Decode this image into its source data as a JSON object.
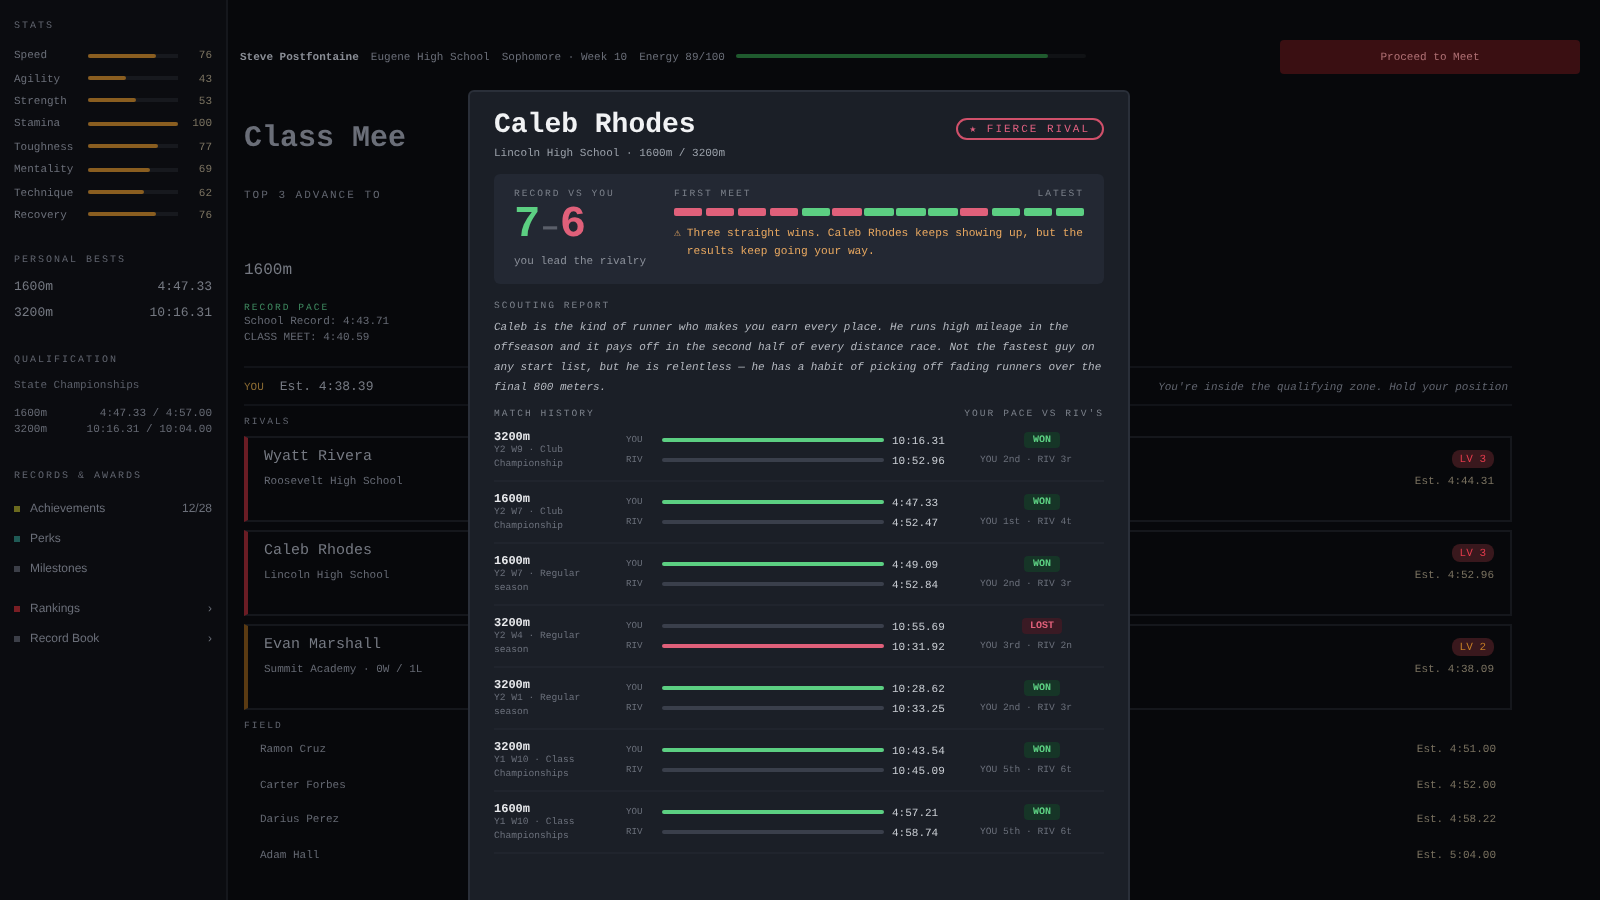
{
  "sidebar": {
    "stats_title": "STATS",
    "stats": [
      {
        "name": "Speed",
        "level": 0.76,
        "value": "76"
      },
      {
        "name": "Agility",
        "level": 0.43,
        "value": "43"
      },
      {
        "name": "Strength",
        "level": 0.53,
        "value": "53"
      },
      {
        "name": "Stamina",
        "level": 1.0,
        "value": "100"
      },
      {
        "name": "Toughness",
        "level": 0.77,
        "value": "77"
      },
      {
        "name": "Mentality",
        "level": 0.69,
        "value": "69"
      },
      {
        "name": "Technique",
        "level": 0.62,
        "value": "62"
      },
      {
        "name": "Recovery",
        "level": 0.76,
        "value": "76"
      }
    ],
    "bests_title": "PERSONAL BESTS",
    "bests": [
      {
        "event": "1600m",
        "time": "4:47.33"
      },
      {
        "event": "3200m",
        "time": "10:16.31"
      }
    ],
    "qualification_title": "QUALIFICATION",
    "qualification_meet": "State Championships",
    "qualification": [
      {
        "event": "1600m",
        "time": "4:47.33 / 4:57.00"
      },
      {
        "event": "3200m",
        "time": "10:16.31 / 10:04.00"
      }
    ],
    "records_title": "RECORDS & AWARDS",
    "records": [
      {
        "label": "Achievements",
        "count": "12/28",
        "color": "#6b6a1e"
      },
      {
        "label": "Perks",
        "color": "#1f5a55"
      },
      {
        "label": "Milestones",
        "color": "#3c3f48"
      }
    ],
    "links": [
      {
        "label": "Rankings",
        "chevron": "›",
        "color": "#7a1e24"
      },
      {
        "label": "Record Book",
        "chevron": "›",
        "color": "#3c3f48"
      }
    ]
  },
  "top_bar": {
    "athlete": "Steve Postfontaine",
    "school": "Eugene High School",
    "season": "Sophomore · Week 10",
    "energy": "Energy 89/100",
    "level": 0.89,
    "button": "Proceed to Meet"
  },
  "meet": {
    "title": "Class Mee",
    "rule": "TOP 3 ADVANCE TO",
    "event": "1600m",
    "record_title": "RECORD PACE",
    "records": [
      "School Record: 4:43.71",
      "CLASS MEET: 4:40.59"
    ],
    "you_label": "YOU",
    "you_estimate": "Est. 4:38.39",
    "you_message": "You're inside the qualifying zone. Hold your position",
    "rivals_title": "RIVALS",
    "rivals": [
      {
        "name": "Wyatt Rivera",
        "school": "Roosevelt High School",
        "badge": "LV 3",
        "estimate": "Est. 4:44.31",
        "color": "#6a1c24"
      },
      {
        "name": "Caleb Rhodes",
        "school": "Lincoln High School",
        "badge": "LV 3",
        "estimate": "Est. 4:52.96",
        "color": "#6a1c24"
      },
      {
        "name": "Evan Marshall",
        "school": "Summit Academy · 0W / 1L",
        "badge": "LV 2",
        "estimate": "Est. 4:38.09",
        "color": "#5a3a12"
      }
    ],
    "field_title": "FIELD",
    "field": [
      {
        "name": "Ramon Cruz",
        "estimate": "Est. 4:51.00"
      },
      {
        "name": "Carter Forbes",
        "estimate": "Est. 4:52.00"
      },
      {
        "name": "Darius Perez",
        "estimate": "Est. 4:58.22"
      },
      {
        "name": "Adam Hall",
        "estimate": "Est. 5:04.00"
      }
    ]
  },
  "modal": {
    "name": "Caleb Rhodes",
    "subtitle": "Lincoln High School · 1600m / 3200m",
    "badge": "★ FIERCE RIVAL",
    "record_title": "RECORD VS YOU",
    "wins": "7",
    "dash": "–",
    "losses": "6",
    "record_note": "you lead the rivalry",
    "first_label": "FIRST MEET",
    "latest_label": "LATEST",
    "meets": [
      {
        "won": false
      },
      {
        "won": false
      },
      {
        "won": false
      },
      {
        "won": false
      },
      {
        "won": true
      },
      {
        "won": false
      },
      {
        "won": true
      },
      {
        "won": true
      },
      {
        "won": true
      },
      {
        "won": false
      },
      {
        "won": true
      },
      {
        "won": true
      },
      {
        "won": true
      }
    ],
    "message_icon": "⚠",
    "message": "Three straight wins. Caleb Rhodes keeps showing up, but the results keep going your way.",
    "scouting_title": "SCOUTING REPORT",
    "scouting": "Caleb is the kind of runner who makes you earn every place. He runs high mileage in the offseason and it pays off in the second half of every distance race. Not the fastest guy on any start list, but he is relentless — he has a habit of picking off fading runners over the final 800 meters.",
    "history_title": "MATCH HISTORY",
    "history_legend": "YOUR PACE VS RIV'S",
    "matches": [
      {
        "event": "3200m",
        "meet": "Y2 W9 · Club Championship",
        "you_label": "YOU",
        "riv_label": "RIV",
        "you": "10:16.31",
        "riv": "10:52.96",
        "won": true,
        "result": "WON",
        "places": "YOU 2nd · RIV 3r"
      },
      {
        "event": "1600m",
        "meet": "Y2 W7 · Club Championship",
        "you_label": "YOU",
        "riv_label": "RIV",
        "you": "4:47.33",
        "riv": "4:52.47",
        "won": true,
        "result": "WON",
        "places": "YOU 1st · RIV 4t"
      },
      {
        "event": "1600m",
        "meet": "Y2 W7 · Regular season",
        "you_label": "YOU",
        "riv_label": "RIV",
        "you": "4:49.09",
        "riv": "4:52.84",
        "won": true,
        "result": "WON",
        "places": "YOU 2nd · RIV 3r"
      },
      {
        "event": "3200m",
        "meet": "Y2 W4 · Regular season",
        "you_label": "YOU",
        "riv_label": "RIV",
        "you": "10:55.69",
        "riv": "10:31.92",
        "won": false,
        "result": "LOST",
        "places": "YOU 3rd · RIV 2n"
      },
      {
        "event": "3200m",
        "meet": "Y2 W1 · Regular season",
        "you_label": "YOU",
        "riv_label": "RIV",
        "you": "10:28.62",
        "riv": "10:33.25",
        "won": true,
        "result": "WON",
        "places": "YOU 2nd · RIV 3r"
      },
      {
        "event": "3200m",
        "meet": "Y1 W10 · Class Championships",
        "you_label": "YOU",
        "riv_label": "RIV",
        "you": "10:43.54",
        "riv": "10:45.09",
        "won": true,
        "result": "WON",
        "places": "YOU 5th · RIV 6t"
      },
      {
        "event": "1600m",
        "meet": "Y1 W10 · Class Championships",
        "you_label": "YOU",
        "riv_label": "RIV",
        "you": "4:57.21",
        "riv": "4:58.74",
        "won": true,
        "result": "WON",
        "places": "YOU 5th · RIV 6t"
      }
    ]
  }
}
